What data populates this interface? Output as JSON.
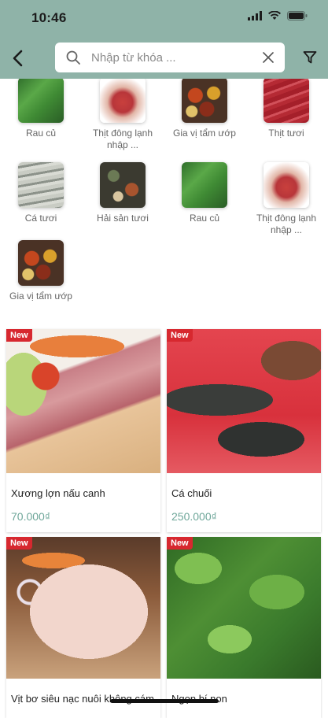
{
  "status": {
    "time": "10:46"
  },
  "search": {
    "placeholder": "Nhập từ khóa ..."
  },
  "categories": [
    {
      "label": "Rau củ"
    },
    {
      "label": "Thịt đông lạnh nhập ..."
    },
    {
      "label": "Gia vị tẩm ướp"
    },
    {
      "label": "Thịt tươi"
    },
    {
      "label": "Cá tươi"
    },
    {
      "label": "Hải sản tươi"
    },
    {
      "label": "Rau củ"
    },
    {
      "label": "Thịt đông lạnh nhập ..."
    },
    {
      "label": "Gia vị tẩm ướp"
    }
  ],
  "products": [
    {
      "badge": "New",
      "name": "Xương lợn nấu canh",
      "price": "70.000₫"
    },
    {
      "badge": "New",
      "name": "Cá chuối",
      "price": "250.000₫"
    },
    {
      "badge": "New",
      "name": "Vịt bơ siêu nạc nuôi không cám",
      "price": ""
    },
    {
      "badge": "New",
      "name": "Ngọn bí non",
      "price": ""
    }
  ],
  "colors": {
    "header": "#8fb3a8",
    "price": "#6fa79a",
    "badge": "#d7282f"
  }
}
